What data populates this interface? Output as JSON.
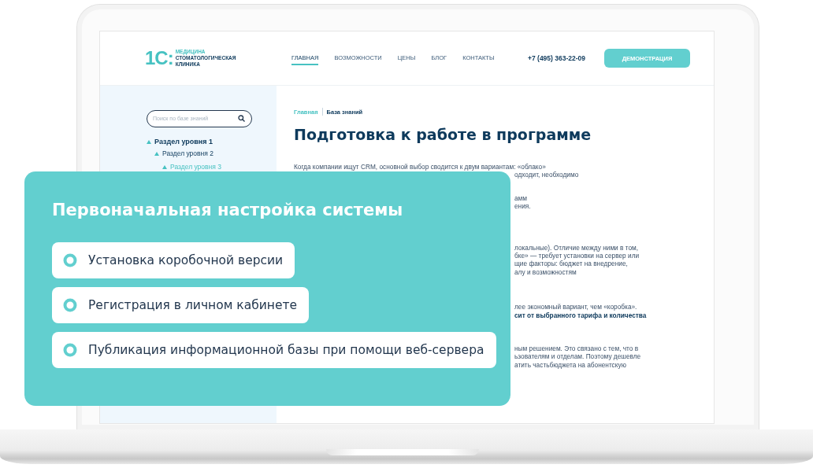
{
  "header": {
    "logo": {
      "mark": "1С:",
      "line_1": "МЕДИЦИНА",
      "line_2": "СТОМАТОЛОГИЧЕСКАЯ",
      "line_3": "КЛИНИКА"
    },
    "nav": [
      {
        "label": "ГЛАВНАЯ",
        "selected": true
      },
      {
        "label": "ВОЗМОЖНОСТИ",
        "selected": false
      },
      {
        "label": "ЦЕНЫ",
        "selected": false
      },
      {
        "label": "БЛОГ",
        "selected": false
      },
      {
        "label": "КОНТАКТЫ",
        "selected": false
      }
    ],
    "phone": "+7 (495) 363-22-09",
    "button": "ДЕМОНСТРАЦИЯ"
  },
  "sidebar": {
    "search": {
      "placeholder": "Поиск по базе знаний"
    },
    "tree": [
      {
        "label": "Раздел уровня 1",
        "selected": false,
        "children": [
          {
            "label": "Раздел уровня 2",
            "selected": false,
            "children": [
              {
                "label": "Раздел уровня 3",
                "selected": true
              }
            ]
          }
        ]
      }
    ]
  },
  "breadcrumb": [
    {
      "label": "Главная",
      "kind": "link"
    },
    {
      "label": "База знаний",
      "kind": "current"
    }
  ],
  "title": "Подготовка к работе в программе",
  "paragraphs": [
    {
      "lines": [
        {
          "text": "Когда компании ищут CRM, основной выбор сводится к двум вариантам: «облако»",
          "kind": "full",
          "bold": false
        },
        {
          "text": "одходит, необходимо",
          "kind": "tail",
          "bold": false
        }
      ]
    },
    {
      "lines": [
        {
          "text": "амм",
          "kind": "tail",
          "bold": false
        },
        {
          "text": "ения.",
          "kind": "tail",
          "bold": false
        }
      ]
    },
    {
      "lines": [
        {
          "text": "локальные). Отличие между ними в том,",
          "kind": "tail",
          "bold": false
        },
        {
          "text": "бке» — требует установки на сервер или",
          "kind": "tail",
          "bold": false
        },
        {
          "text": "щие факторы: бюджет на внедрение,",
          "kind": "tail",
          "bold": false
        },
        {
          "text": "алу и возможностям",
          "kind": "tail",
          "bold": false
        }
      ]
    },
    {
      "lines": [
        {
          "text": "лее экономный вариант, чем «коробка».",
          "kind": "tail",
          "bold": false
        },
        {
          "text": "сит от выбранного тарифа и количества",
          "kind": "tail",
          "bold": true
        }
      ]
    },
    {
      "lines": [
        {
          "text": "ным решением. Это связано с тем, что в",
          "kind": "tail",
          "bold": false
        },
        {
          "text": "ьзователям и отделам. Поэтому дешевле",
          "kind": "tail",
          "bold": false
        },
        {
          "text": "атить частьбюджета на абонентскую",
          "kind": "tail",
          "bold": false
        }
      ]
    }
  ],
  "card": {
    "title": "Первоначальная настройка системы",
    "items": [
      "Установка коробочной версии",
      "Регистрация в личном кабинете",
      "Публикация информационной базы при помощи веб-сервера"
    ]
  }
}
